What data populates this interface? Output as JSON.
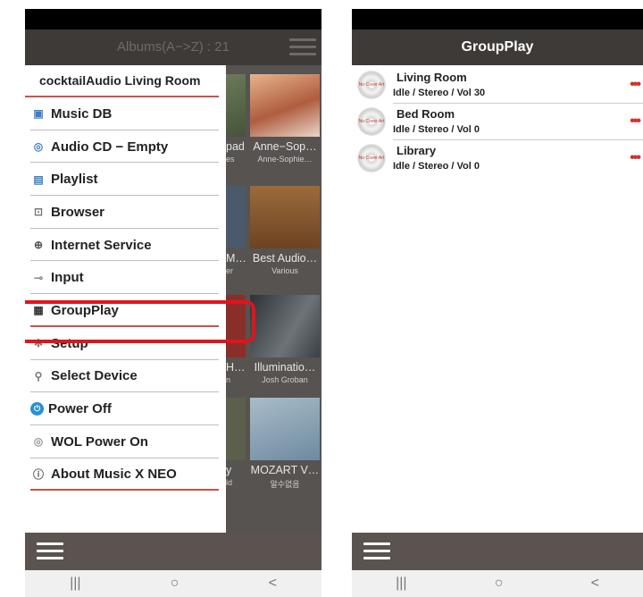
{
  "left": {
    "title": "Albums(A−>Z) : 21",
    "drawer_header": "cocktailAudio Living Room",
    "menu": [
      {
        "label": "Music DB",
        "icon": "music-db-icon"
      },
      {
        "label": "Audio CD − Empty",
        "icon": "audio-cd-icon"
      },
      {
        "label": "Playlist",
        "icon": "playlist-icon"
      },
      {
        "label": "Browser",
        "icon": "browser-icon"
      },
      {
        "label": "Internet Service",
        "icon": "globe-icon"
      },
      {
        "label": "Input",
        "icon": "input-icon"
      },
      {
        "label": "GroupPlay",
        "icon": "groupplay-icon"
      },
      {
        "label": "Setup",
        "icon": "gear-icon"
      },
      {
        "label": "Select Device",
        "icon": "search-icon"
      },
      {
        "label": "Power Off",
        "icon": "power-icon"
      },
      {
        "label": "WOL Power On",
        "icon": "wol-icon"
      },
      {
        "label": "About Music X NEO",
        "icon": "info-icon"
      }
    ],
    "albums": [
      {
        "title": "pad",
        "artist": "es"
      },
      {
        "title": "Anne−Sop…",
        "artist": "Anne-Sophie…"
      },
      {
        "title": "M…",
        "artist": "er"
      },
      {
        "title": "Best Audio…",
        "artist": "Various"
      },
      {
        "title": "H…",
        "artist": "n"
      },
      {
        "title": "Illuminatio…",
        "artist": "Josh Groban"
      },
      {
        "title": "y",
        "artist": "ld"
      },
      {
        "title": "MOZART V…",
        "artist": "알수없음"
      }
    ]
  },
  "right": {
    "title": "GroupPlay",
    "cover_label": "No Cover Art",
    "groups": [
      {
        "name": "Living Room",
        "status": "Idle / Stereo / Vol 30"
      },
      {
        "name": "Bed Room",
        "status": "Idle / Stereo / Vol 0"
      },
      {
        "name": "Library",
        "status": "Idle / Stereo / Vol 0"
      }
    ],
    "more_symbol": "•••"
  },
  "nav": {
    "recents": "|||",
    "home": "○",
    "back": "<"
  },
  "colors": {
    "accent": "#c9524b",
    "highlight": "#e0141e",
    "appbar": "#3e3a38"
  }
}
